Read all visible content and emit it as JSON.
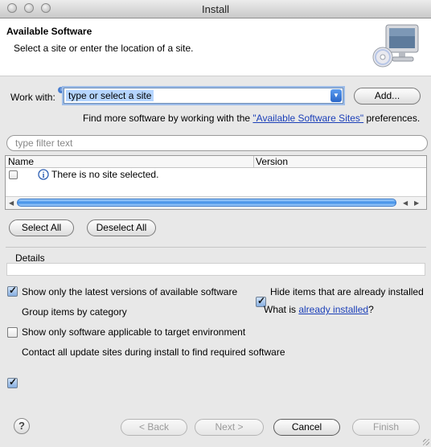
{
  "window": {
    "title": "Install"
  },
  "header": {
    "title": "Available Software",
    "description": "Select a site or enter the location of a site."
  },
  "work_with": {
    "label": "Work with:",
    "value": "type or select a site",
    "add_button": "Add..."
  },
  "find_more": {
    "prefix": "Find more software by working with the ",
    "link": "\"Available Software Sites\"",
    "suffix": " preferences."
  },
  "filter": {
    "placeholder": "type filter text"
  },
  "table": {
    "columns": [
      "Name",
      "Version"
    ],
    "message": "There is no site selected."
  },
  "selection_buttons": {
    "select_all": "Select All",
    "deselect_all": "Deselect All"
  },
  "details": {
    "label": "Details"
  },
  "options": {
    "latest_versions": {
      "label": "Show only the latest versions of available software",
      "checked": true
    },
    "hide_installed": {
      "label": "Hide items that are already installed",
      "checked": true
    },
    "group_by_category": {
      "label": "Group items by category",
      "checked": true
    },
    "what_is": {
      "prefix": "What is ",
      "link": "already installed",
      "suffix": "?"
    },
    "target_env": {
      "label": "Show only software applicable to target environment",
      "checked": false
    },
    "contact_sites": {
      "label": "Contact all update sites during install to find required software",
      "checked": true
    }
  },
  "footer": {
    "help": "?",
    "back": "< Back",
    "next": "Next >",
    "cancel": "Cancel",
    "finish": "Finish"
  },
  "colors": {
    "link": "#1b3fb8",
    "selection": "#b5d5ff",
    "progress": "#5aa8f0"
  }
}
